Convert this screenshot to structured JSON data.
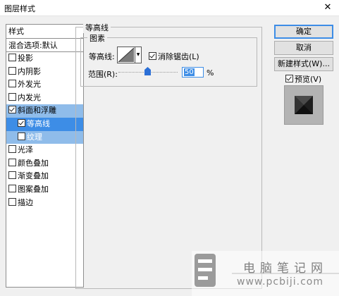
{
  "window": {
    "title": "图层样式",
    "close_glyph": "✕"
  },
  "sidebar": {
    "header": "样式",
    "blend_options": "混合选项:默认",
    "items": [
      {
        "label": "投影",
        "checked": false
      },
      {
        "label": "内阴影",
        "checked": false
      },
      {
        "label": "外发光",
        "checked": false
      },
      {
        "label": "内发光",
        "checked": false
      },
      {
        "label": "斜面和浮雕",
        "checked": true
      },
      {
        "label": "等高线",
        "checked": true
      },
      {
        "label": "纹理",
        "checked": false
      },
      {
        "label": "光泽",
        "checked": false
      },
      {
        "label": "颜色叠加",
        "checked": false
      },
      {
        "label": "渐变叠加",
        "checked": false
      },
      {
        "label": "图案叠加",
        "checked": false
      },
      {
        "label": "描边",
        "checked": false
      }
    ]
  },
  "panel": {
    "title": "等高线",
    "group_title": "图素",
    "contour_label": "等高线:",
    "antialias_label": "消除锯齿(L)",
    "antialias_checked": true,
    "range_label": "范围(R):",
    "range_value": "50",
    "range_unit": "%"
  },
  "buttons": {
    "ok": "确定",
    "cancel": "取消",
    "new_style": "新建样式(W)...",
    "preview_label": "预览(V)",
    "preview_checked": true
  },
  "watermark": {
    "cn": "电脑笔记网",
    "url": "www.pcbiji.com"
  },
  "colors": {
    "selection": "#3d8de6",
    "selection_light": "#8fbcea"
  }
}
